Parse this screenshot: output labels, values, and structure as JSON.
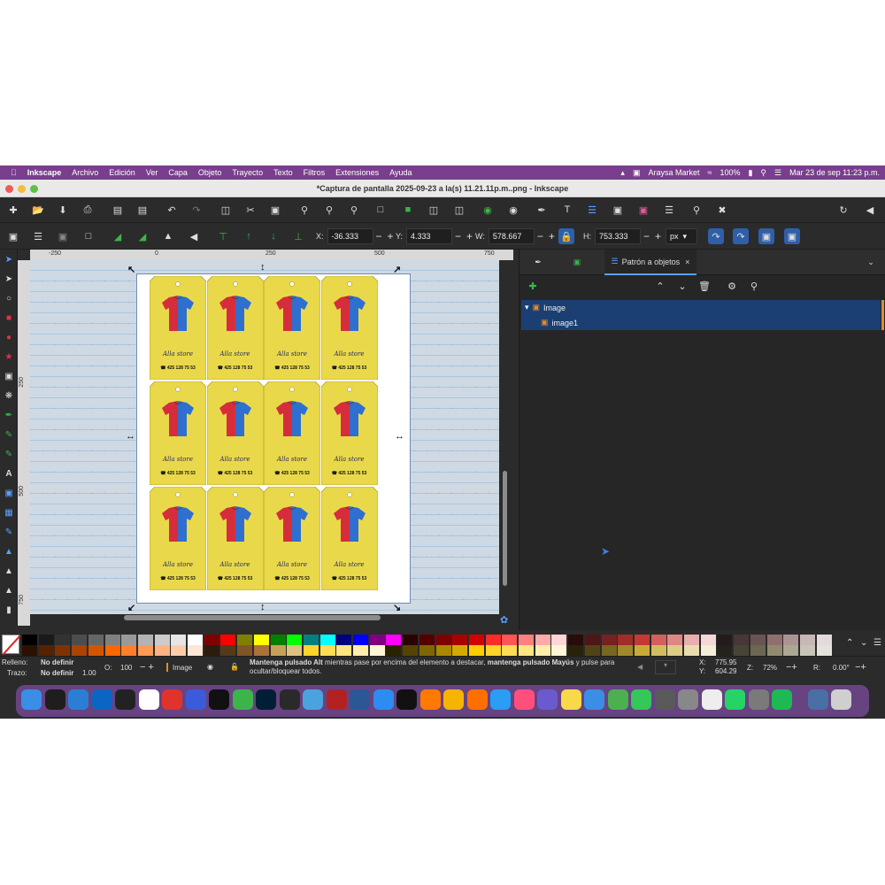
{
  "menubar": {
    "app": "Inkscape",
    "items": [
      "Archivo",
      "Edición",
      "Ver",
      "Capa",
      "Objeto",
      "Trayecto",
      "Texto",
      "Filtros",
      "Extensiones",
      "Ayuda"
    ],
    "network_label": "Araysa Market",
    "battery": "100%",
    "datetime": "Mar 23 de sep  11:23 p.m."
  },
  "window": {
    "title": "*Captura de pantalla 2025-09-23 a la(s) 11.21.11p.m..png - Inkscape"
  },
  "controls": {
    "x_label": "X:",
    "x_value": "-36.333",
    "y_label": "Y:",
    "y_value": "4.333",
    "w_label": "W:",
    "w_value": "578.667",
    "h_label": "H:",
    "h_value": "753.333",
    "unit": "px"
  },
  "ruler": {
    "h_ticks": [
      "-250",
      "0",
      "250",
      "500",
      "750"
    ],
    "v_ticks": [
      "250",
      "500",
      "750"
    ]
  },
  "cards": {
    "signature": "Alla store",
    "phone": "425 128 75 53"
  },
  "panel": {
    "tab_label": "Patrón a objetos",
    "close": "×",
    "rows": [
      "Image",
      "image1"
    ]
  },
  "status": {
    "fill_label": "Relleno:",
    "fill_value": "No definir",
    "stroke_label": "Trazo:",
    "stroke_value": "No definir",
    "stroke_width": "1.00",
    "opacity_label": "O:",
    "opacity_value": "100",
    "layer": "Image",
    "message_bold1": "Mantenga pulsado Alt",
    "message_1": " mientras pase por encima del elemento a destacar, ",
    "message_bold2": "mantenga pulsado Mayús",
    "message_2": " y pulse para ocultar/bloquear todos.",
    "cx_label": "X:",
    "cx_value": "775.95",
    "cy_label": "Y:",
    "cy_value": "604.29",
    "zoom_label": "Z:",
    "zoom_value": "72%",
    "rot_label": "R:",
    "rot_value": "0.00°"
  },
  "colors": {
    "menubar": "#7a3e8e",
    "card_yellow": "#e9d94a",
    "shirt_red": "#d62d3c",
    "shirt_blue": "#2f6fd0",
    "selection": "#1b3f73"
  }
}
